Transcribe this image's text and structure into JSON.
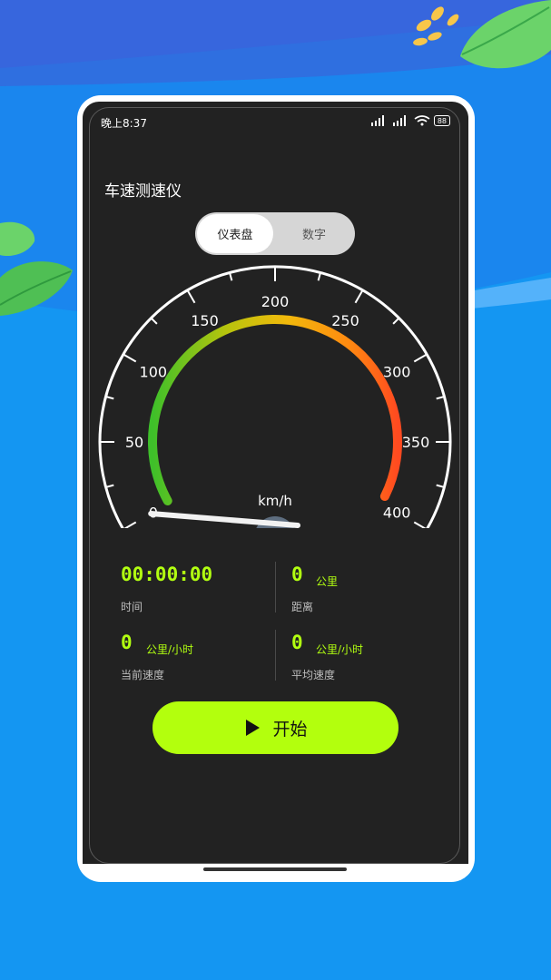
{
  "status_bar": {
    "time": "晚上8:37",
    "battery": "88"
  },
  "app": {
    "title": "车速测速仪"
  },
  "toggle": {
    "active_label": "仪表盘",
    "inactive_label": "数字"
  },
  "gauge": {
    "unit": "km/h",
    "ticks": [
      "0",
      "50",
      "100",
      "150",
      "200",
      "250",
      "300",
      "350",
      "400"
    ],
    "min": 0,
    "max": 400,
    "current_speed": 0,
    "display_ghost": "88",
    "display_value": "0"
  },
  "stats": {
    "time_value": "00:00:00",
    "time_label": "时间",
    "distance_value": "0",
    "distance_unit": "公里",
    "distance_label": "距离",
    "current_speed_value": "0",
    "current_speed_unit": "公里/小时",
    "current_speed_label": "当前速度",
    "avg_speed_value": "0",
    "avg_speed_unit": "公里/小时",
    "avg_speed_label": "平均速度"
  },
  "start_button": {
    "label": "开始"
  },
  "colors": {
    "accent_green": "#b3ff0d",
    "screen_bg": "#222222",
    "page_bg": "#1a86ee",
    "lcd_cyan": "#19c3ea"
  }
}
